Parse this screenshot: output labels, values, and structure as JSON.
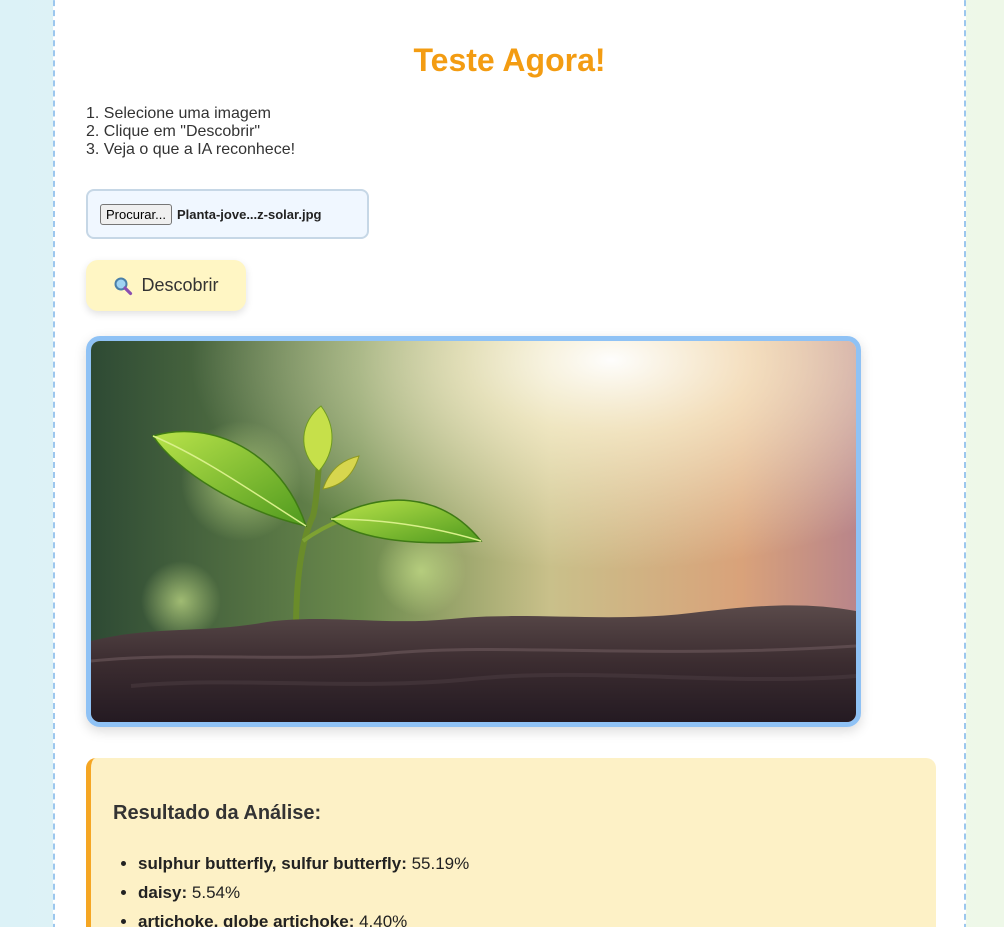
{
  "page": {
    "title": "Teste Agora!"
  },
  "steps": [
    "1. Selecione uma imagem",
    "2. Clique em \"Descobrir\"",
    "3. Veja o que a IA reconhece!"
  ],
  "file_input": {
    "button_label": "Procurar...",
    "file_name": "Planta-jove...z-solar.jpg"
  },
  "discover_button": {
    "icon": "magnifier-icon",
    "label": "Descobrir"
  },
  "preview": {
    "alt": "Planta jovem ao sol"
  },
  "result": {
    "title": "Resultado da Análise:",
    "items": [
      {
        "label": "sulphur butterfly, sulfur butterfly",
        "value": "55.19%"
      },
      {
        "label": "daisy",
        "value": "5.54%"
      },
      {
        "label": "artichoke, globe artichoke",
        "value": "4.40%"
      }
    ]
  },
  "colors": {
    "title": "#f39c12",
    "accent": "#f5a623",
    "frame": "#8fc2f5",
    "result_bg": "#fdf1c6",
    "button_bg": "#fff6c4"
  }
}
